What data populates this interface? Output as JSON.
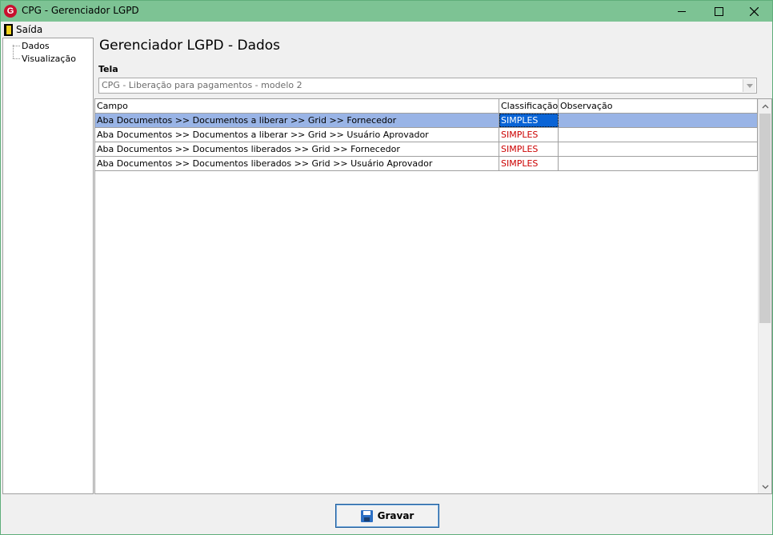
{
  "window": {
    "title": "CPG - Gerenciador LGPD",
    "logo_letter": "G"
  },
  "menu": {
    "items": [
      {
        "label": "Saída",
        "icon": "exit-door-icon"
      }
    ]
  },
  "tree": {
    "items": [
      {
        "label": "Dados"
      },
      {
        "label": "Visualização"
      }
    ]
  },
  "main": {
    "heading": "Gerenciador LGPD - Dados",
    "tela_label": "Tela",
    "tela_value": "CPG - Liberação para pagamentos - modelo 2"
  },
  "grid": {
    "columns": [
      "Campo",
      "Classificação",
      "Observação"
    ],
    "rows": [
      {
        "campo": "Aba Documentos >> Documentos a liberar >> Grid >> Fornecedor",
        "classificacao": "SIMPLES",
        "observacao": ""
      },
      {
        "campo": "Aba Documentos >> Documentos a liberar >> Grid >> Usuário Aprovador",
        "classificacao": "SIMPLES",
        "observacao": ""
      },
      {
        "campo": "Aba Documentos >> Documentos liberados >> Grid >> Fornecedor",
        "classificacao": "SIMPLES",
        "observacao": ""
      },
      {
        "campo": "Aba Documentos >> Documentos liberados >> Grid >> Usuário Aprovador",
        "classificacao": "SIMPLES",
        "observacao": ""
      }
    ],
    "selected_row": 0
  },
  "footer": {
    "save_label": "Gravar",
    "save_icon": "floppy-disk-icon"
  },
  "colors": {
    "titlebar": "#7dc394",
    "selected_row": "#99b4e6",
    "classification_text": "#cc0000"
  }
}
